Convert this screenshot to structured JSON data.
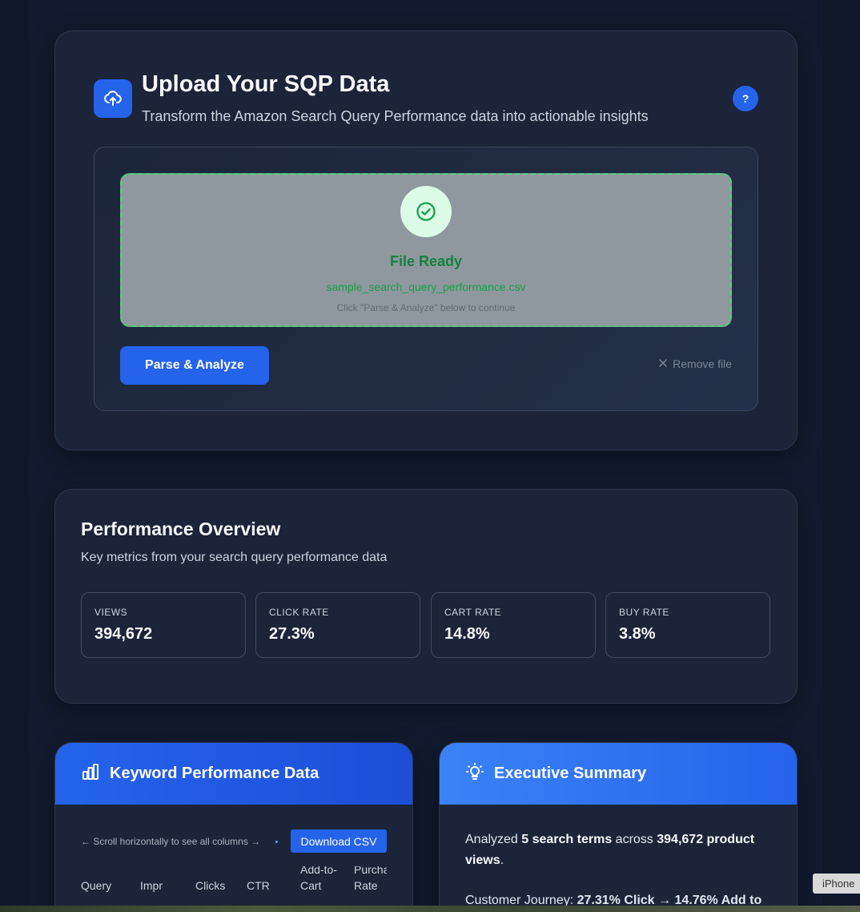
{
  "upload": {
    "title": "Upload Your SQP Data",
    "subtitle": "Transform the Amazon Search Query Performance data into actionable insights",
    "help_label": "?",
    "dropzone": {
      "status": "File Ready",
      "file_name": "sample_search_query_performance.csv",
      "hint": "Click \"Parse & Analyze\" below to continue"
    },
    "parse_button": "Parse & Analyze",
    "remove_label": "Remove file"
  },
  "performance": {
    "title": "Performance Overview",
    "subtitle": "Key metrics from your search query performance data",
    "metrics": [
      {
        "label": "VIEWS",
        "value": "394,672"
      },
      {
        "label": "CLICK RATE",
        "value": "27.3%"
      },
      {
        "label": "CART RATE",
        "value": "14.8%"
      },
      {
        "label": "BUY RATE",
        "value": "3.8%"
      }
    ]
  },
  "keywords": {
    "title": "Keyword Performance Data",
    "scroll_hint": "← Scroll horizontally to see all columns →",
    "download_button": "Download CSV",
    "columns": [
      "Query",
      "Impr",
      "Clicks",
      "CTR",
      "Add-to-Cart",
      "Purchase Rate"
    ]
  },
  "executive": {
    "title": "Executive Summary",
    "line1_a": "Analyzed ",
    "line1_b": "5 search terms",
    "line1_c": " across ",
    "line1_d": "394,672 product views",
    "line1_e": ".",
    "line2_a": "Customer Journey: ",
    "line2_b": "27.31% Click → 14.76% Add to"
  },
  "device_tag": "iPhone",
  "colors": {
    "accent": "#2563eb",
    "success": "#16a34a",
    "background": "#0f172a",
    "card": "#1b2438"
  }
}
